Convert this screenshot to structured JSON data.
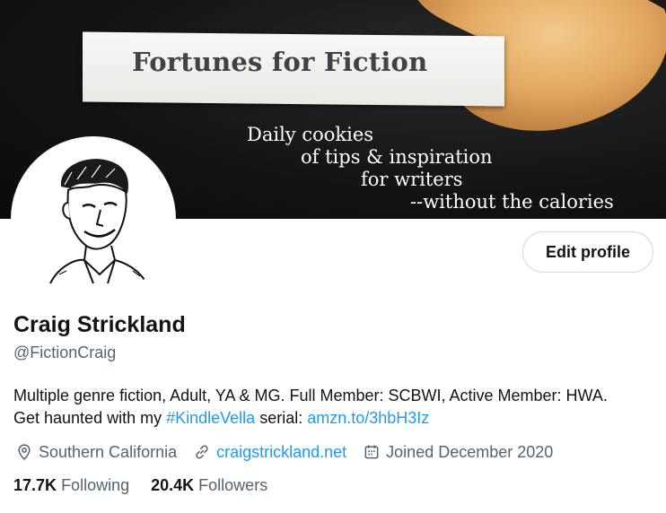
{
  "banner": {
    "title": "Fortunes for Fiction",
    "tagline": [
      "Daily cookies",
      "of tips & inspiration",
      "for writers",
      "--without the calories"
    ]
  },
  "profile": {
    "edit_label": "Edit profile",
    "name": "Craig Strickland",
    "handle": "@FictionCraig",
    "bio_line1": "Multiple genre fiction, Adult, YA & MG. Full Member: SCBWI, Active Member: HWA.",
    "bio_line2_prefix": "Get haunted with my ",
    "bio_hashtag": "#KindleVella",
    "bio_line2_middle": " serial: ",
    "bio_link": "amzn.to/3hbH3Iz"
  },
  "meta": {
    "location_icon": "location-pin-icon",
    "location": "Southern California",
    "link_icon": "link-icon",
    "website": "craigstrickland.net",
    "calendar_icon": "calendar-icon",
    "joined": "Joined December 2020"
  },
  "stats": {
    "following_count": "17.7K",
    "following_label": "Following",
    "followers_count": "20.4K",
    "followers_label": "Followers"
  },
  "colors": {
    "accent": "#1d9bf0",
    "secondary_text": "#536471",
    "primary_text": "#0f1419"
  }
}
